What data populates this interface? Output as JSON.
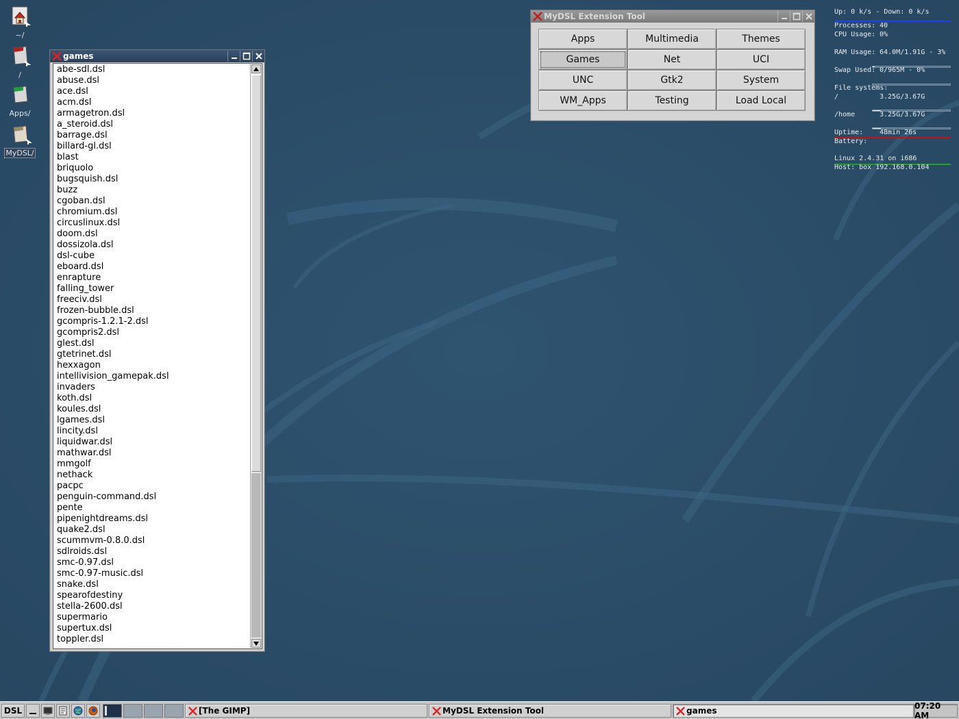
{
  "desktop": {
    "icons": [
      {
        "label": "~/"
      },
      {
        "label": "/"
      },
      {
        "label": "Apps/"
      },
      {
        "label": "MyDSL/"
      }
    ]
  },
  "games_window": {
    "title": "games",
    "items": [
      "abe-sdl.dsl",
      "abuse.dsl",
      "ace.dsl",
      "acm.dsl",
      "armagetron.dsl",
      "a_steroid.dsl",
      "barrage.dsl",
      "billard-gl.dsl",
      "blast",
      "briquolo",
      "bugsquish.dsl",
      "buzz",
      "cgoban.dsl",
      "chromium.dsl",
      "circuslinux.dsl",
      "doom.dsl",
      "dossizola.dsl",
      "dsl-cube",
      "eboard.dsl",
      "enrapture",
      "falling_tower",
      "freeciv.dsl",
      "frozen-bubble.dsl",
      "gcompris-1.2.1-2.dsl",
      "gcompris2.dsl",
      "glest.dsl",
      "gtetrinet.dsl",
      "hexxagon",
      "intellivision_gamepak.dsl",
      "invaders",
      "koth.dsl",
      "koules.dsl",
      "lgames.dsl",
      "lincity.dsl",
      "liquidwar.dsl",
      "mathwar.dsl",
      "mmgolf",
      "nethack",
      "pacpc",
      "penguin-command.dsl",
      "pente",
      "pipenightdreams.dsl",
      "quake2.dsl",
      "scummvm-0.8.0.dsl",
      "sdlroids.dsl",
      "smc-0.97.dsl",
      "smc-0.97-music.dsl",
      "snake.dsl",
      "spearofdestiny",
      "stella-2600.dsl",
      "supermario",
      "supertux.dsl",
      "toppler.dsl"
    ]
  },
  "mydsl_window": {
    "title": "MyDSL Extension Tool",
    "buttons": [
      "Apps",
      "Multimedia",
      "Themes",
      "Games",
      "Net",
      "UCI",
      "UNC",
      "Gtk2",
      "System",
      "WM_Apps",
      "Testing",
      "Load Local"
    ],
    "active_button": "Games"
  },
  "conky": {
    "net": "Up: 0 k/s - Down: 0 k/s",
    "processes_label": "Processes:",
    "processes_value": "40",
    "cpu_label": "CPU Usage:",
    "cpu_value": "0%",
    "ram_label": "RAM Usage:",
    "ram_value": "64.0M/1.91G - 3%",
    "ram_fraction": 0.03,
    "swap_label": "Swap Used:",
    "swap_value": "0/965M - 0%",
    "swap_fraction": 0.0,
    "fs_label": "File systems:",
    "fs_root_label": "/",
    "fs_root_value": "3.25G/3.67G",
    "fs_root_fraction": 0.11,
    "fs_home_label": "/home",
    "fs_home_value": "3.25G/3.67G",
    "fs_home_fraction": 0.11,
    "uptime_label": "Uptime:",
    "uptime_value": "48min 26s",
    "battery_label": "Battery:",
    "kernel": "Linux 2.4.31 on i686",
    "host": "Host: box 192.168.0.104",
    "colors": {
      "net_line": "#2040ff",
      "fs_line": "#cc1010",
      "uptime_line": "#20a020"
    }
  },
  "taskbar": {
    "start_label": "DSL",
    "tasks": [
      "[The GIMP]",
      "MyDSL Extension Tool",
      "games"
    ],
    "clock": "07:20 AM"
  }
}
